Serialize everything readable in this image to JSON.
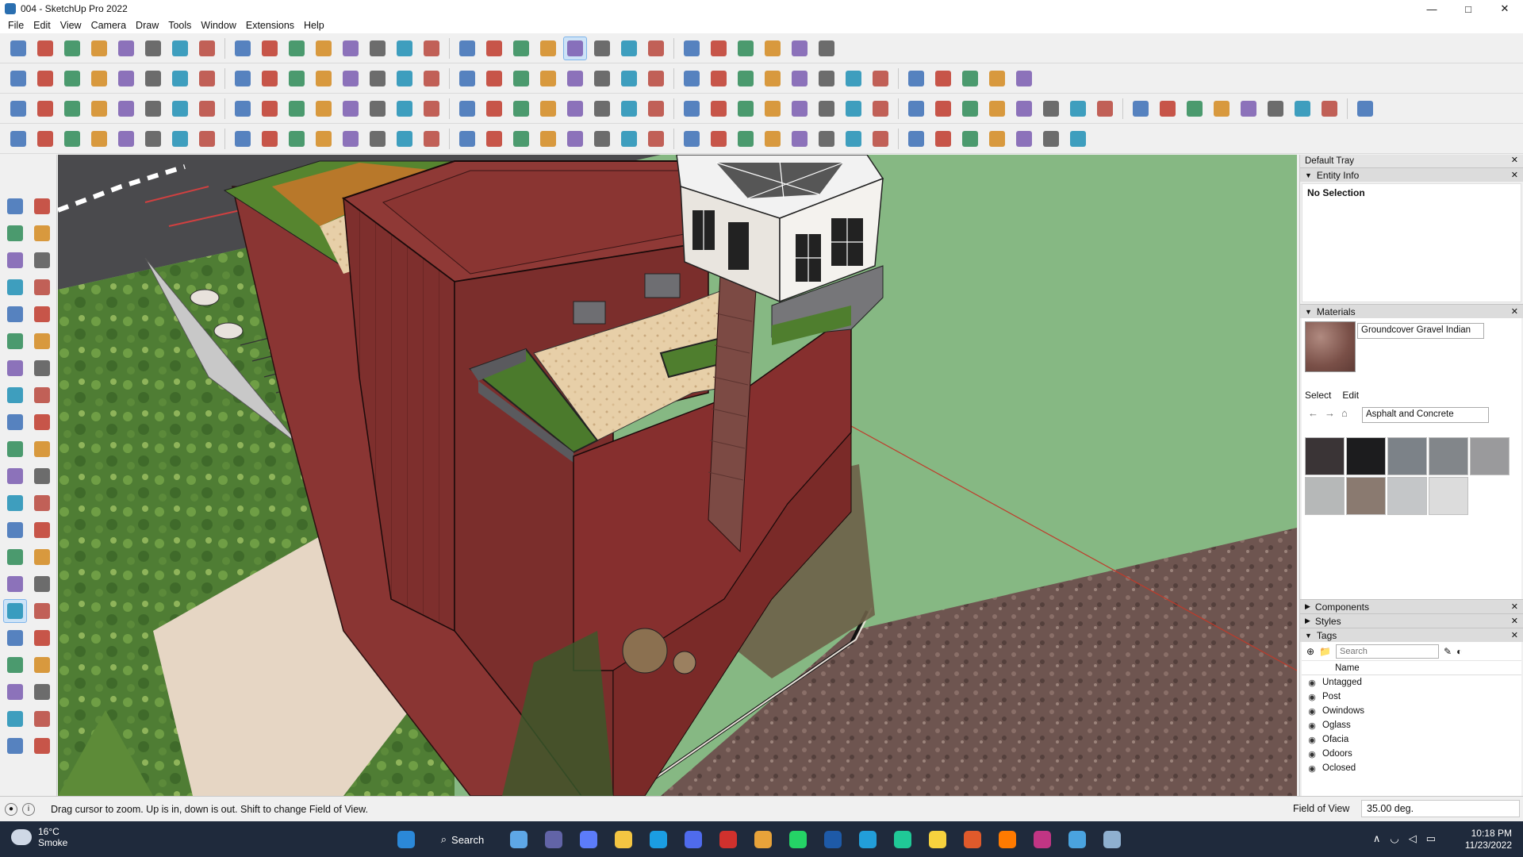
{
  "window": {
    "title": "004 - SketchUp Pro 2022",
    "controls": [
      "minimize-icon",
      "maximize-icon",
      "close-icon"
    ]
  },
  "menu": [
    "File",
    "Edit",
    "View",
    "Camera",
    "Draw",
    "Tools",
    "Window",
    "Extensions",
    "Help"
  ],
  "toolbars": {
    "row1_icons": [
      "zoom-icon",
      "select-icon",
      "chevron-down-icon",
      "eraser-icon",
      "line-icon",
      "chevron-down-icon",
      "lasso-icon",
      "chevron-down-icon",
      "paint-bucket-icon",
      "chevron-down-icon",
      "push-pull-icon",
      "follow-me-icon",
      "move-icon",
      "rotate-icon",
      "scale-icon",
      "tape-measure-icon",
      "text-icon",
      "paint-icon",
      "orbit-icon",
      "pan-icon",
      "zoom-icon",
      "zoom-extents-icon",
      "outliner-icon",
      "layers-icon",
      "layers-icon",
      "layers-icon",
      "user-icon",
      "chevron-down-icon",
      "sandbox-icon",
      "extension-icon"
    ],
    "row2_icons": [
      "iso-view-icon",
      "top-view-icon",
      "front-view-icon",
      "right-view-icon",
      "back-view-icon",
      "left-view-icon",
      "xray-icon",
      "hidden-line-icon",
      "wireframe-icon",
      "shaded-icon",
      "textured-icon",
      "monochrome-icon",
      "section-icon",
      "section-fill-icon",
      "section-cut-icon",
      "arc-icon",
      "pencil-icon",
      "shape-icon",
      "circle-icon",
      "ellipse-icon",
      "polygon-icon",
      "freehand-icon",
      "offset-icon",
      "spline-icon",
      "bezier-icon",
      "dimension-icon",
      "protractor-icon",
      "intersect-icon",
      "flip-icon",
      "axes-icon",
      "axes-icon",
      "axes-icon",
      "axes-icon",
      "axes-icon",
      "axes-icon",
      "warehouse-icon",
      "extension-icon"
    ],
    "row3_icons": [
      "solid-icon",
      "solid-icon",
      "solid-icon",
      "solid-icon",
      "solid-icon",
      "solid-icon",
      "solid-icon",
      "follow-icon",
      "cone-icon",
      "cylinder-icon",
      "sphere-icon",
      "torus-icon",
      "box-icon",
      "box-icon",
      "group-icon",
      "component-icon",
      "rotate-icon",
      "orbit-icon",
      "rotate-icon",
      "tape-icon",
      "tape-icon",
      "camera-icon",
      "frame-icon",
      "frame-icon",
      "frame-icon",
      "frame-icon",
      "line-icon",
      "curve-icon",
      "curve-icon",
      "curve-icon",
      "curve-icon",
      "curve-icon",
      "curve-icon",
      "curve-icon",
      "arc-icon",
      "arc-icon",
      "arc-icon",
      "arc-icon",
      "stair-icon",
      "stair-icon",
      "stair-icon",
      "stair-icon",
      "stair-icon",
      "stair-icon",
      "stair-icon",
      "stair-icon",
      "stair-icon",
      "stair-icon",
      "stair-icon"
    ],
    "row4_icons": [
      "shape-icon",
      "shape-icon",
      "shape-icon",
      "shape-icon",
      "shape-icon",
      "shape-icon",
      "arc-icon",
      "grid-icon",
      "grid-icon",
      "flag-icon",
      "box-icon",
      "tool-icon",
      "curve-icon",
      "curve-icon",
      "plus-icon",
      "plus-icon",
      "cross-icon",
      "cone-icon",
      "cone-icon",
      "triangle-icon",
      "lasso-icon",
      "lasso-icon",
      "lasso-icon",
      "axis-icon",
      "cylinder-icon",
      "undo-icon",
      "tree-icon",
      "tool-icon",
      "tool-icon",
      "tool-icon",
      "tool-icon",
      "tool-icon",
      "grid-icon",
      "grid-icon",
      "grid-icon",
      "grid-icon",
      "cross-icon",
      "circle-icon",
      "grid-icon"
    ]
  },
  "left_toolbar_icons": [
    "select-icon",
    "orbit-icon",
    "paint-bucket-icon",
    "eraser-icon",
    "component-icon",
    "tape-icon",
    "line-icon",
    "freehand-icon",
    "rectangle-icon",
    "rotated-rectangle-icon",
    "circle-icon",
    "polygon-icon",
    "arc-icon",
    "arc-icon",
    "pie-icon",
    "arc-icon",
    "move-icon",
    "push-pull-icon",
    "rotate-icon",
    "follow-me-icon",
    "scale-icon",
    "offset-icon",
    "tape-measure-icon",
    "dimension-icon",
    "protractor-icon",
    "text-icon",
    "axes-icon",
    "3d-text-icon",
    "orbit-icon",
    "pan-icon",
    "zoom-icon",
    "zoom-window-icon",
    "zoom-extents-icon",
    "previous-view-icon",
    "position-camera-icon",
    "look-around-icon",
    "walk-icon",
    "section-plane-icon",
    "outliner-icon",
    "layers-icon",
    "layers-icon",
    "layers-icon"
  ],
  "tray": {
    "title": "Default Tray",
    "entity_info": {
      "header": "Entity Info",
      "selection": "No Selection"
    },
    "materials": {
      "header": "Materials",
      "current_name": "Groundcover Gravel Indian",
      "tabs": [
        "Select",
        "Edit"
      ],
      "library": "Asphalt and Concrete",
      "swatch_colors": [
        "#3a3436",
        "#1c1c1e",
        "#7c8288",
        "#82868a",
        "#9a9a9c",
        "#b6b8b8",
        "#8a7a70",
        "#c4c6c8",
        "#dcdcdc"
      ]
    },
    "collapsed_panels": [
      "Components",
      "Styles"
    ],
    "tags": {
      "header": "Tags",
      "search_placeholder": "Search",
      "column": "Name",
      "items": [
        "Untagged",
        "Post",
        "Owindows",
        "Oglass",
        "Ofacia",
        "Odoors",
        "Oclosed"
      ]
    }
  },
  "status": {
    "message": "Drag cursor to zoom.  Up is in, down is out. Shift to change Field of View.",
    "measure_label": "Field of View",
    "measure_value": "35.00 deg."
  },
  "taskbar": {
    "weather_temp": "16°C",
    "weather_desc": "Smoke",
    "search_label": "Search",
    "apps": [
      "windows-start-icon",
      "file-explorer-icon",
      "teams-icon",
      "calculator-icon",
      "folder-icon",
      "edge-icon",
      "store-icon",
      "opera-icon",
      "chrome-icon",
      "whatsapp-icon",
      "sketchup-icon",
      "telegram-icon",
      "app-icon",
      "sticky-notes-icon",
      "g-icon",
      "soundcloud-icon",
      "instagram-icon",
      "photos-icon",
      "app-icon"
    ],
    "time": "10:18 PM",
    "date": "11/23/2022"
  },
  "colors": {
    "accent": "#cde3f7",
    "brick": "#7a2e2c",
    "grass": "#5f8f3a",
    "taskbar": "#1f2a3c"
  }
}
